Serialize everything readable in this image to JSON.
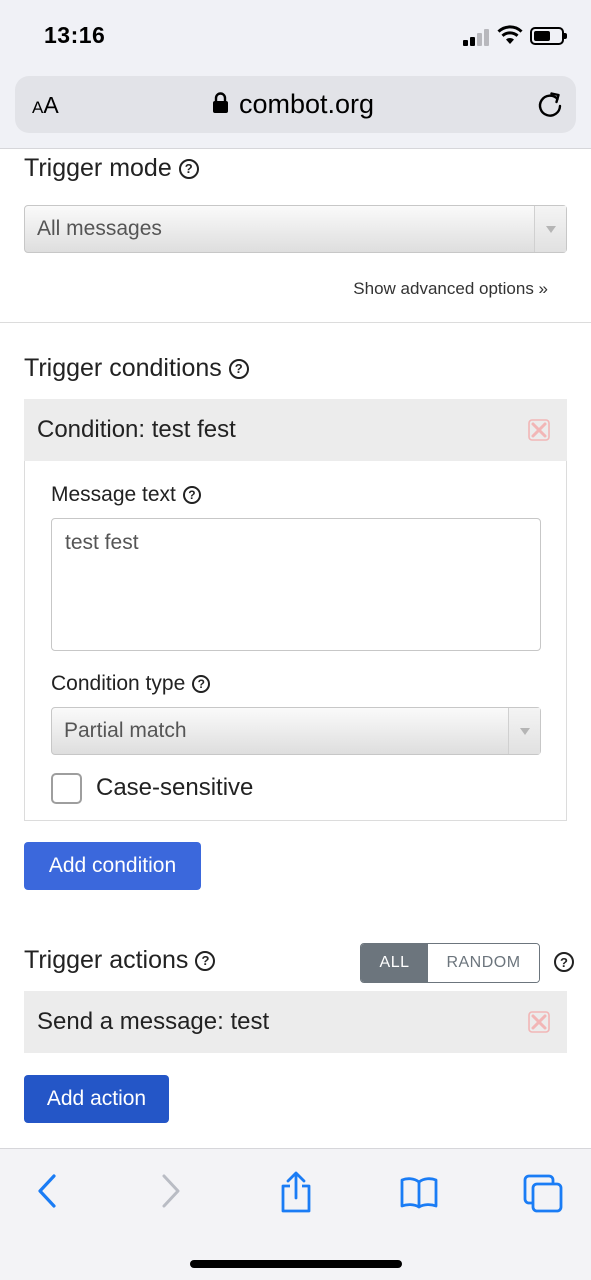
{
  "status_bar": {
    "time": "13:16",
    "battery_level": 0.6
  },
  "browser": {
    "text_size_small": "A",
    "text_size_large": "A",
    "url": "combot.org",
    "icons": [
      "lock-icon",
      "reload-icon"
    ]
  },
  "trigger_mode": {
    "title": "Trigger mode",
    "help": "?",
    "selected": "All messages",
    "advanced_link": "Show advanced options »"
  },
  "trigger_conditions": {
    "title": "Trigger conditions",
    "help": "?",
    "condition_header": "Condition: test fest",
    "message_text_label": "Message text",
    "message_text_value": "test fest",
    "condition_type_label": "Condition type",
    "condition_type_selected": "Partial match",
    "case_sensitive_label": "Case-sensitive",
    "case_sensitive_checked": false,
    "add_button": "Add condition"
  },
  "trigger_actions": {
    "title": "Trigger actions",
    "help": "?",
    "toggle_all": "ALL",
    "toggle_random": "RANDOM",
    "toggle_selected": "ALL",
    "action_header": "Send a message: test",
    "add_button": "Add action"
  },
  "toolbar": {
    "icons": [
      "back-icon",
      "forward-icon",
      "share-icon",
      "bookmarks-icon",
      "tabs-icon"
    ]
  },
  "colors": {
    "primary_button": "#3b68dc",
    "toggle_active": "#6c757d",
    "remove_icon": "#f2b6b6",
    "ios_blue": "#1a7cf5"
  }
}
